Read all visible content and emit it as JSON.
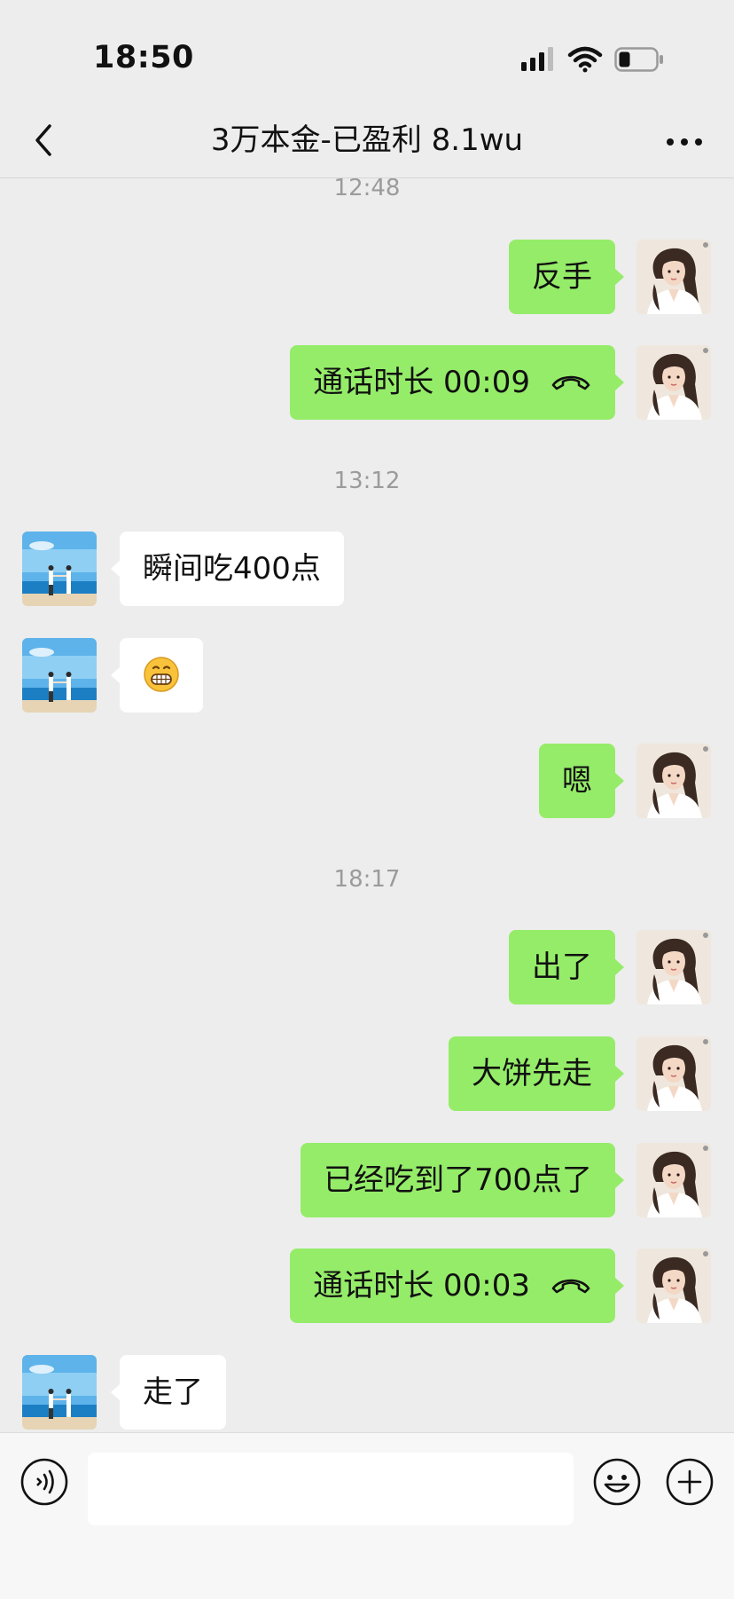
{
  "status_bar": {
    "time": "18:50",
    "icons": [
      "signal-icon",
      "wifi-icon",
      "battery-icon"
    ]
  },
  "nav": {
    "title": "3万本金-已盈利 8.1wu",
    "back_icon": "chevron-left-icon",
    "more_icon": "more-dots-icon"
  },
  "colors": {
    "background": "#ededed",
    "self_bubble": "#95ec69",
    "peer_bubble": "#ffffff",
    "timestamp": "#9b9b9b"
  },
  "messages": {
    "ts1": "12:48",
    "m1": "反手",
    "m2": "通话时长 00:09",
    "ts2": "13:12",
    "m3": "瞬间吃400点",
    "m4": "grinning-face-emoji",
    "m5": "嗯",
    "ts3": "18:17",
    "m6": "出了",
    "m7": "大饼先走",
    "m8": "已经吃到了700点了",
    "m9": "通话时长 00:03",
    "m10": "走了"
  },
  "input_bar": {
    "placeholder": "",
    "icons": [
      "voice-icon",
      "sticker-icon",
      "plus-icon"
    ]
  }
}
